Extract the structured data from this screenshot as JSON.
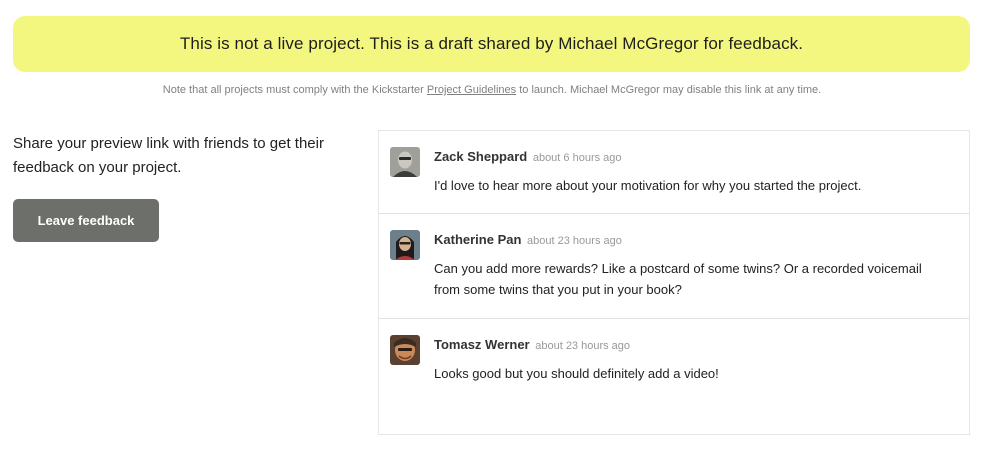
{
  "banner": {
    "text": "This is not a live project. This is a draft shared by Michael McGregor for feedback."
  },
  "note": {
    "prefix": "Note that all projects must comply with the Kickstarter ",
    "link_label": "Project Guidelines",
    "suffix": " to launch. Michael McGregor may disable this link at any time."
  },
  "share": {
    "text": "Share your preview link with friends to get their feedback on your project.",
    "button_label": "Leave feedback"
  },
  "comments": [
    {
      "author": "Zack Sheppard",
      "time": "about 6 hours ago",
      "text": "I'd love to hear more about your motivation for why you started the project."
    },
    {
      "author": "Katherine Pan",
      "time": "about 23 hours ago",
      "text": "Can you add more rewards? Like a postcard of some twins? Or a recorded voicemail from some twins that you put in your book?"
    },
    {
      "author": "Tomasz Werner",
      "time": "about 23 hours ago",
      "text": "Looks good but you should definitely add a video!"
    }
  ],
  "colors": {
    "banner_bg": "#f3f77f",
    "button_bg": "#6d6f6a"
  }
}
